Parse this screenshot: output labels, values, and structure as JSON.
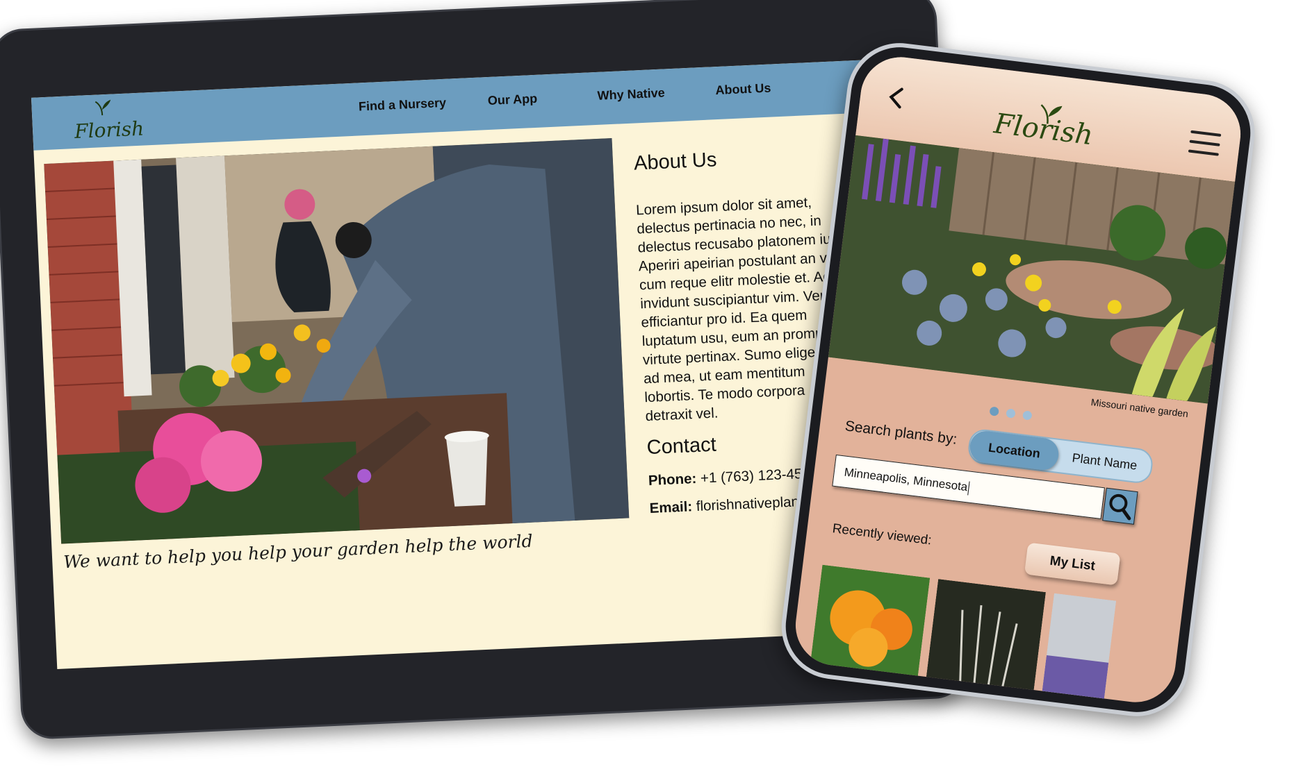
{
  "tablet": {
    "logo_text": "Florish",
    "nav": [
      "Find a Nursery",
      "Our App",
      "Why Native",
      "About Us"
    ],
    "caption": "We want to help you help your garden help the world",
    "about_title": "About Us",
    "about_lines": [
      "Lorem ipsum dolor sit amet,",
      "delectus pertinacia no nec, in",
      "delectus recusabo platonem ius.",
      "Aperiri apeirian postulant an vel,",
      "cum reque elitr molestie et. Ad",
      "invidunt suscipiantur vim. Verit",
      "efficiantur pro id. Ea quem",
      "luptatum usu, eum an prompt",
      "virtute pertinax. Sumo eligen",
      "ad mea, ut eam mentitum",
      "lobortis. Te modo corpora",
      "detraxit vel."
    ],
    "contact_title": "Contact",
    "phone_label": "Phone:",
    "phone_value": "+1 (763) 123-456",
    "email_label": "Email:",
    "email_value": "florishnativeplant"
  },
  "phone": {
    "logo_text": "Florish",
    "photo_caption": "Missouri native garden",
    "carousel": {
      "count": 3,
      "active": 0
    },
    "search_label": "Search plants by:",
    "toggle_on": "Location",
    "toggle_off": "Plant Name",
    "search_value": "Minneapolis, Minnesota",
    "recent_label": "Recently viewed:",
    "my_list": "My List"
  },
  "icons": {
    "back": "chevron-left-icon",
    "menu": "hamburger-menu-icon",
    "search": "magnifier-icon",
    "sprout": "sprout-icon"
  },
  "colors": {
    "nav_blue": "#6c9dbf",
    "cream": "#fcf4d8",
    "peach": "#e2b29a",
    "logo_green": "#2b4a12"
  }
}
